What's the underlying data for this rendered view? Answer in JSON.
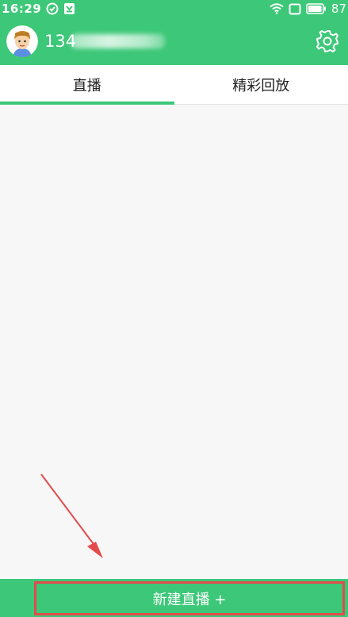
{
  "status_bar": {
    "time": "16:29",
    "battery": "87"
  },
  "header": {
    "username_visible": "134"
  },
  "tabs": [
    {
      "label": "直播",
      "active": true
    },
    {
      "label": "精彩回放",
      "active": false
    }
  ],
  "bottom": {
    "new_live_label": "新建直播 +"
  },
  "colors": {
    "brand_green": "#3cc878",
    "highlight_red": "#e24b4b",
    "content_bg": "#f7f7f7"
  },
  "icons": {
    "status_left": [
      "check-circle-icon",
      "shield-download-icon"
    ],
    "status_right": [
      "wifi-icon",
      "square-icon",
      "battery-icon"
    ],
    "header_right": "gear-icon"
  }
}
